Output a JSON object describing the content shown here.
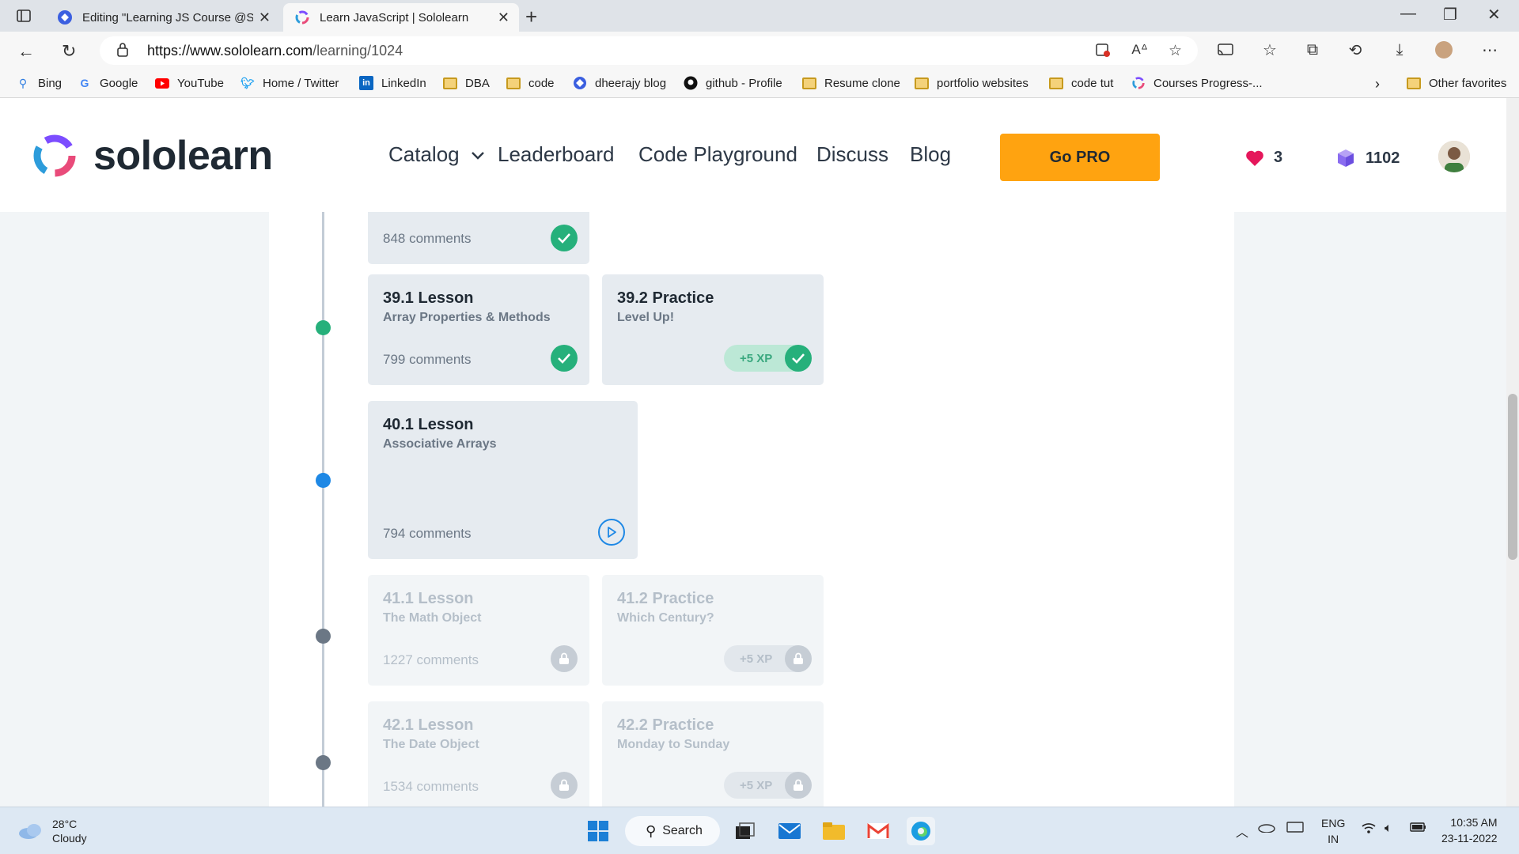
{
  "browser": {
    "tabs": [
      {
        "title": "Editing \"Learning JS Course @Sc",
        "active": false
      },
      {
        "title": "Learn JavaScript | Sololearn",
        "active": true
      }
    ],
    "url_host": "https://www.sololearn.com",
    "url_path": "/learning/1024",
    "bookmarks": [
      {
        "label": "Bing",
        "icon": "search-icon"
      },
      {
        "label": "Google",
        "icon": "google-icon"
      },
      {
        "label": "YouTube",
        "icon": "youtube-icon"
      },
      {
        "label": "Home / Twitter",
        "icon": "twitter-icon"
      },
      {
        "label": "LinkedIn",
        "icon": "linkedin-icon"
      },
      {
        "label": "DBA",
        "icon": "folder-icon"
      },
      {
        "label": "code",
        "icon": "folder-icon"
      },
      {
        "label": "dheerajy blog",
        "icon": "blog-icon"
      },
      {
        "label": "github - Profile",
        "icon": "github-icon"
      },
      {
        "label": "Resume clone",
        "icon": "folder-icon"
      },
      {
        "label": "portfolio websites",
        "icon": "folder-icon"
      },
      {
        "label": "code tut",
        "icon": "folder-icon"
      },
      {
        "label": "Courses Progress-...",
        "icon": "sololearn-icon"
      }
    ],
    "other_favorites": "Other favorites"
  },
  "site": {
    "logo_text": "sololearn",
    "nav": {
      "catalog": "Catalog",
      "leaderboard": "Leaderboard",
      "code_playground": "Code Playground",
      "discuss": "Discuss",
      "blog": "Blog"
    },
    "go_pro": "Go PRO",
    "hearts": "3",
    "xp": "1102",
    "colors": {
      "accent": "#ffa310",
      "success": "#26b07b",
      "active": "#1e88e5",
      "heart": "#e5175b"
    }
  },
  "lessons": {
    "prev_card": {
      "comments": "848 comments",
      "status": "completed"
    },
    "m39_lesson": {
      "title": "39.1 Lesson",
      "subtitle": "Array Properties & Methods",
      "comments": "799 comments",
      "status": "completed"
    },
    "m39_practice": {
      "title": "39.2 Practice",
      "subtitle": "Level Up!",
      "xp": "+5 XP",
      "status": "completed"
    },
    "m40_lesson": {
      "title": "40.1 Lesson",
      "subtitle": "Associative Arrays",
      "comments": "794 comments",
      "status": "current"
    },
    "m41_lesson": {
      "title": "41.1 Lesson",
      "subtitle": "The Math Object",
      "comments": "1227 comments",
      "status": "locked"
    },
    "m41_practice": {
      "title": "41.2 Practice",
      "subtitle": "Which Century?",
      "xp": "+5 XP",
      "status": "locked"
    },
    "m42_lesson": {
      "title": "42.1 Lesson",
      "subtitle": "The Date Object",
      "comments": "1534 comments",
      "status": "locked"
    },
    "m42_practice": {
      "title": "42.2 Practice",
      "subtitle": "Monday to Sunday",
      "xp": "+5 XP",
      "status": "locked"
    }
  },
  "taskbar": {
    "temperature": "28°C",
    "weather": "Cloudy",
    "search": "Search",
    "lang_top": "ENG",
    "lang_bottom": "IN",
    "time": "10:35 AM",
    "date": "23-11-2022"
  }
}
